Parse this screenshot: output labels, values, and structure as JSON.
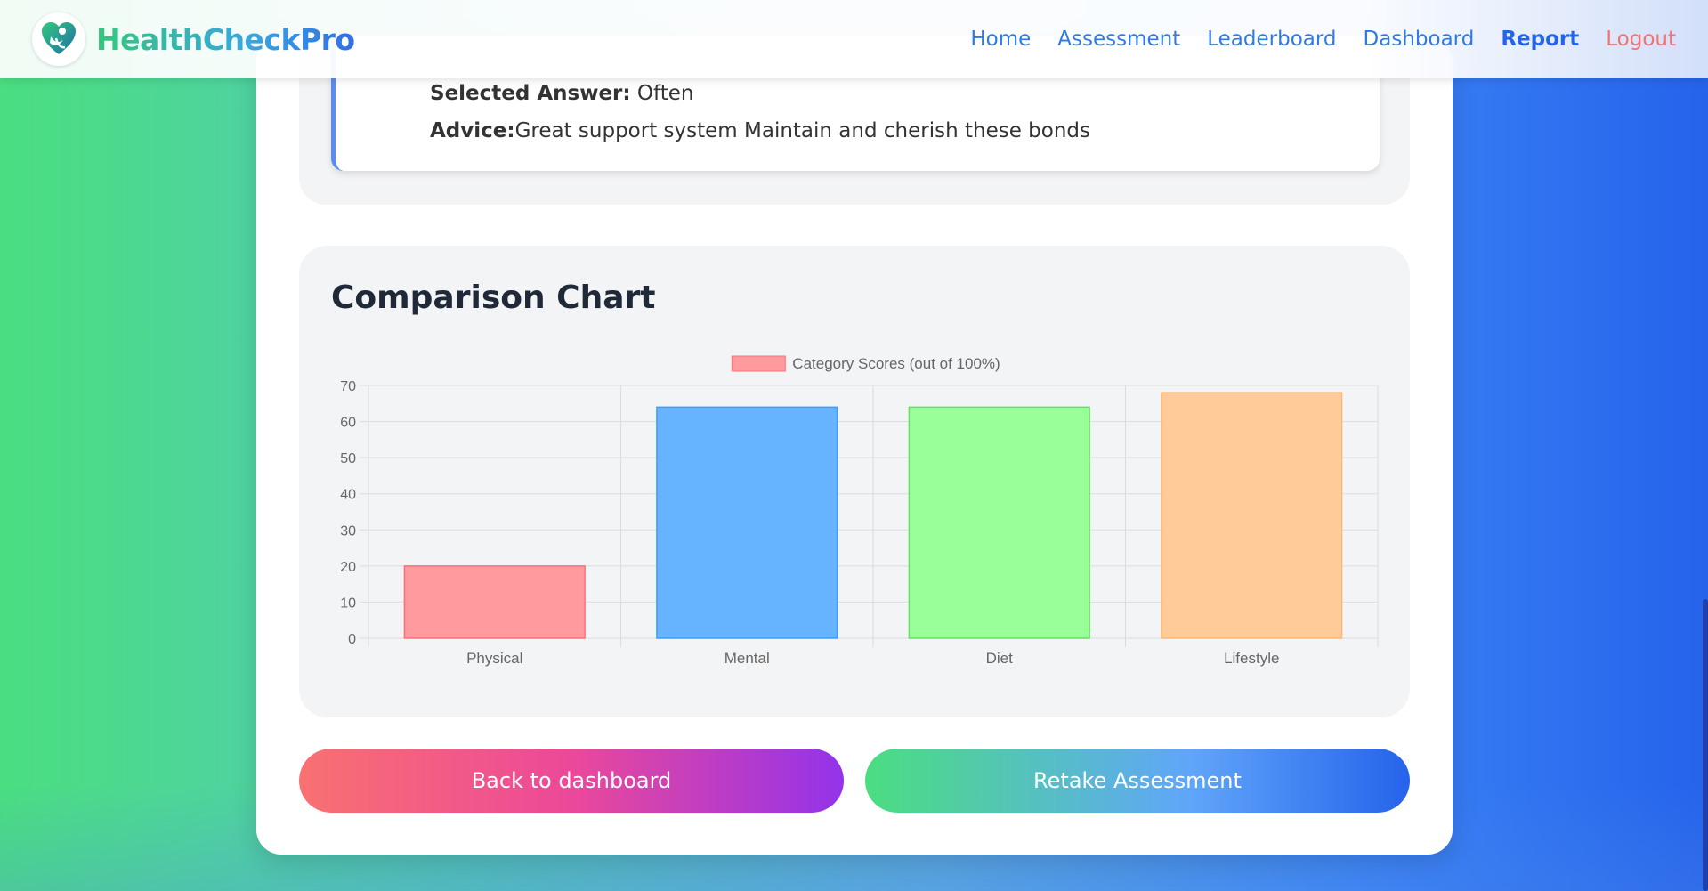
{
  "navbar": {
    "brand": "HealthCheckPro",
    "links": [
      "Home",
      "Assessment",
      "Leaderboard",
      "Dashboard",
      "Report",
      "Logout"
    ]
  },
  "answer": {
    "selected_label": "Selected Answer:",
    "selected_value": " Often",
    "advice_label": "Advice:",
    "advice_value": "Great support system Maintain and cherish these bonds"
  },
  "chart_section": {
    "title": "Comparison Chart"
  },
  "chart_data": {
    "type": "bar",
    "title": "",
    "legend": "Category Scores (out of 100%)",
    "legend_position": "top-center",
    "categories": [
      "Physical",
      "Mental",
      "Diet",
      "Lifestyle"
    ],
    "values": [
      20,
      64,
      64,
      68
    ],
    "colors": [
      "#ff9a9e",
      "#66b3ff",
      "#99ff99",
      "#ffcc99"
    ],
    "border_colors": [
      "#ff6f7a",
      "#3d9bff",
      "#66e066",
      "#ffb870"
    ],
    "ylim": [
      0,
      70
    ],
    "yticks": [
      0,
      10,
      20,
      30,
      40,
      50,
      60,
      70
    ],
    "grid": true
  },
  "buttons": {
    "back": "Back to dashboard",
    "retake": "Retake Assessment"
  }
}
